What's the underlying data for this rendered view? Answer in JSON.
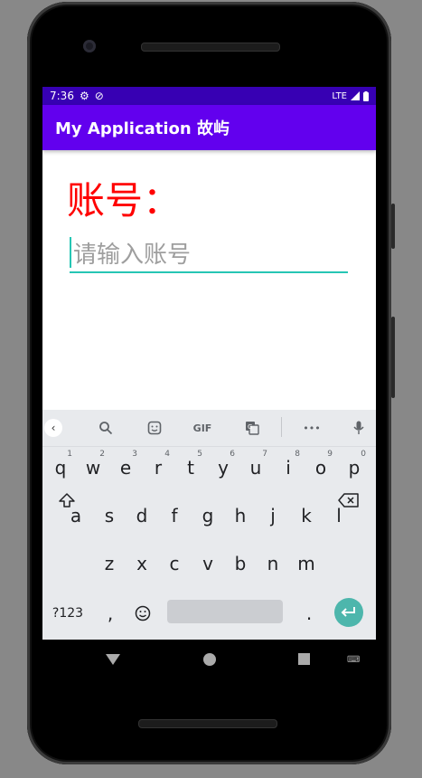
{
  "status": {
    "time": "7:36",
    "network": "LTE"
  },
  "appbar": {
    "title": "My Application 故屿"
  },
  "form": {
    "label": "账号：",
    "placeholder": "请输入账号"
  },
  "keyboard": {
    "toolbar": {
      "gif": "GIF",
      "more": "•••"
    },
    "row1": [
      {
        "k": "q",
        "h": "1"
      },
      {
        "k": "w",
        "h": "2"
      },
      {
        "k": "e",
        "h": "3"
      },
      {
        "k": "r",
        "h": "4"
      },
      {
        "k": "t",
        "h": "5"
      },
      {
        "k": "y",
        "h": "6"
      },
      {
        "k": "u",
        "h": "7"
      },
      {
        "k": "i",
        "h": "8"
      },
      {
        "k": "o",
        "h": "9"
      },
      {
        "k": "p",
        "h": "0"
      }
    ],
    "row2": [
      "a",
      "s",
      "d",
      "f",
      "g",
      "h",
      "j",
      "k",
      "l"
    ],
    "row3": [
      "z",
      "x",
      "c",
      "v",
      "b",
      "n",
      "m"
    ],
    "symbols": "?123",
    "comma": ",",
    "period": "."
  },
  "colors": {
    "accent": "#6200EE",
    "status_bar": "#3700B3",
    "label": "#ff0000",
    "underline": "#26C6B4"
  }
}
